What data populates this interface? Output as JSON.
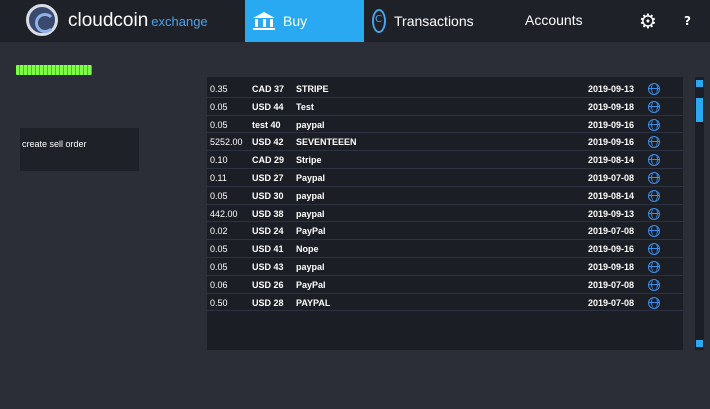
{
  "header": {
    "brand": "cloudcoin",
    "brand_sub": "exchange",
    "nav": {
      "buy": "Buy",
      "transactions": "Transactions",
      "accounts": "Accounts",
      "help": "?"
    },
    "active_tab": "Buy",
    "accent_color": "#29a9f2"
  },
  "progress": {
    "level": 1.0,
    "color": "#7dff4a"
  },
  "sell_button": {
    "label": "create sell order"
  },
  "orders": [
    {
      "amount": "0.35",
      "currency": "CAD 37",
      "payment": "STRIPE",
      "date": "2019-09-13"
    },
    {
      "amount": "0.05",
      "currency": "USD 44",
      "payment": "Test",
      "date": "2019-09-18"
    },
    {
      "amount": "0.05",
      "currency": "test  40",
      "payment": "paypal",
      "date": "2019-09-16"
    },
    {
      "amount": "5252.00",
      "currency": "USD 42",
      "payment": "SEVENTEEEN",
      "date": "2019-09-16"
    },
    {
      "amount": "0.10",
      "currency": "CAD 29",
      "payment": "Stripe",
      "date": "2019-08-14"
    },
    {
      "amount": "0.11",
      "currency": "USD 27",
      "payment": "Paypal",
      "date": "2019-07-08"
    },
    {
      "amount": "0.05",
      "currency": "USD 30",
      "payment": "paypal",
      "date": "2019-08-14"
    },
    {
      "amount": "442.00",
      "currency": "USD 38",
      "payment": "paypal",
      "date": "2019-09-13"
    },
    {
      "amount": "0.02",
      "currency": "USD 24",
      "payment": "PayPal",
      "date": "2019-07-08"
    },
    {
      "amount": "0.05",
      "currency": "USD 41",
      "payment": "Nope",
      "date": "2019-09-16"
    },
    {
      "amount": "0.05",
      "currency": "USD 43",
      "payment": "paypal",
      "date": "2019-09-18"
    },
    {
      "amount": "0.06",
      "currency": "USD 26",
      "payment": "PayPal",
      "date": "2019-07-08"
    },
    {
      "amount": "0.50",
      "currency": "USD 28",
      "payment": "PAYPAL",
      "date": "2019-07-08"
    }
  ],
  "icons": {
    "logo": "cloudcoin-logo-icon",
    "buy": "bank-icon",
    "transactions": "coin-icon",
    "settings": "gear-icon",
    "row_action": "globe-icon"
  }
}
